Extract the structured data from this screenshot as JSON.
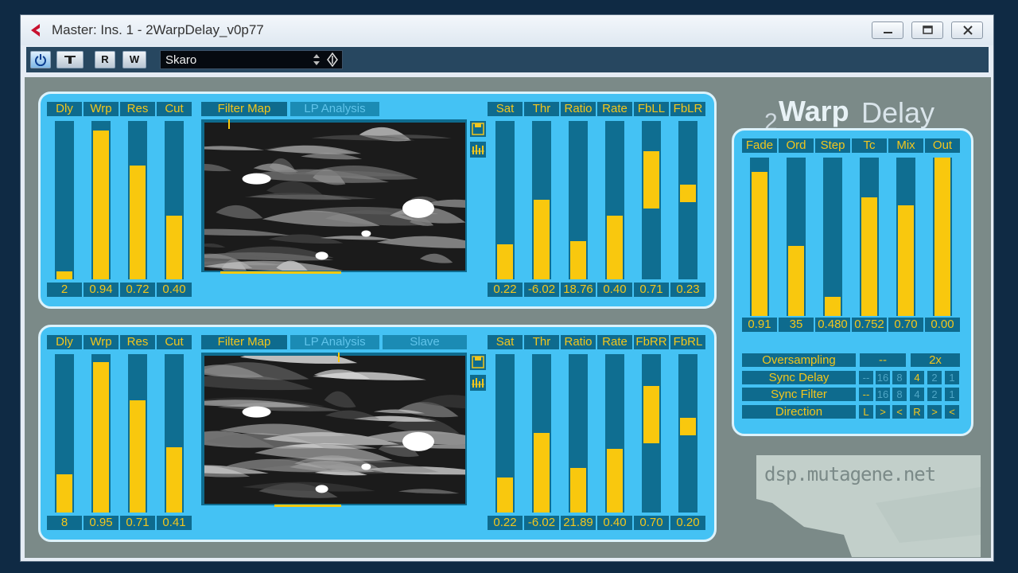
{
  "window": {
    "title": "Master: Ins. 1 - 2WarpDelay_v0p77"
  },
  "toolbar": {
    "r_label": "R",
    "w_label": "W",
    "preset_name": "Skaro"
  },
  "logo": {
    "prefix": "2",
    "warp": "Warp",
    "delay": "Delay"
  },
  "upper": {
    "labels_left": [
      "Dly",
      "Wrp",
      "Res",
      "Cut"
    ],
    "values_left": [
      "2",
      "0.94",
      "0.72",
      "0.40"
    ],
    "levels_left": [
      0.05,
      0.94,
      0.72,
      0.4
    ],
    "tab_filter_map": "Filter Map",
    "tab_lp_analysis": "LP Analysis",
    "labels_right": [
      "Sat",
      "Thr",
      "Ratio",
      "Rate",
      "FbLL",
      "FbLR"
    ],
    "values_right": [
      "0.22",
      "-6.02",
      "18.76",
      "0.40",
      "0.71",
      "0.23"
    ],
    "levels_right": [
      0.22,
      0.5,
      0.24,
      0.4,
      0.71,
      0.23
    ],
    "bipolar": [
      false,
      false,
      false,
      false,
      true,
      true
    ]
  },
  "lower": {
    "labels_left": [
      "Dly",
      "Wrp",
      "Res",
      "Cut"
    ],
    "values_left": [
      "8",
      "0.95",
      "0.71",
      "0.41"
    ],
    "levels_left": [
      0.24,
      0.95,
      0.71,
      0.41
    ],
    "tab_filter_map": "Filter Map",
    "tab_lp_analysis": "LP Analysis",
    "tab_slave": "Slave",
    "labels_right": [
      "Sat",
      "Thr",
      "Ratio",
      "Rate",
      "FbRR",
      "FbRL"
    ],
    "values_right": [
      "0.22",
      "-6.02",
      "21.89",
      "0.40",
      "0.70",
      "0.20"
    ],
    "levels_right": [
      0.22,
      0.5,
      0.28,
      0.4,
      0.7,
      0.2
    ],
    "bipolar": [
      false,
      false,
      false,
      false,
      true,
      true
    ]
  },
  "master": {
    "labels": [
      "Fade",
      "Ord",
      "Step",
      "Tc",
      "Mix",
      "Out"
    ],
    "values": [
      "0.91",
      "35",
      "0.480",
      "0.752",
      "0.70",
      "0.00"
    ],
    "levels": [
      0.91,
      0.44,
      0.12,
      0.75,
      0.7,
      1.0
    ],
    "oversampling_label": "Oversampling",
    "oversampling_off": "--",
    "oversampling_value": "2x",
    "sync_delay_label": "Sync Delay",
    "sync_filter_label": "Sync Filter",
    "direction_label": "Direction",
    "sync_delay_options": [
      "--",
      "16",
      "8",
      "4",
      "2",
      "1"
    ],
    "sync_delay_selected": 3,
    "sync_filter_options": [
      "--",
      "16",
      "8",
      "4",
      "2",
      "1"
    ],
    "sync_filter_selected": 0,
    "direction_options": [
      "L",
      ">",
      "<",
      "R",
      ">",
      "<"
    ]
  },
  "footer": {
    "site": "dsp.mutagene.net"
  },
  "colors": {
    "panel": "#44c2f4",
    "track": "#0f6e91",
    "fill": "#f9c80e",
    "label_bg": "#0e6b8e",
    "label_text": "#f2c61c"
  }
}
